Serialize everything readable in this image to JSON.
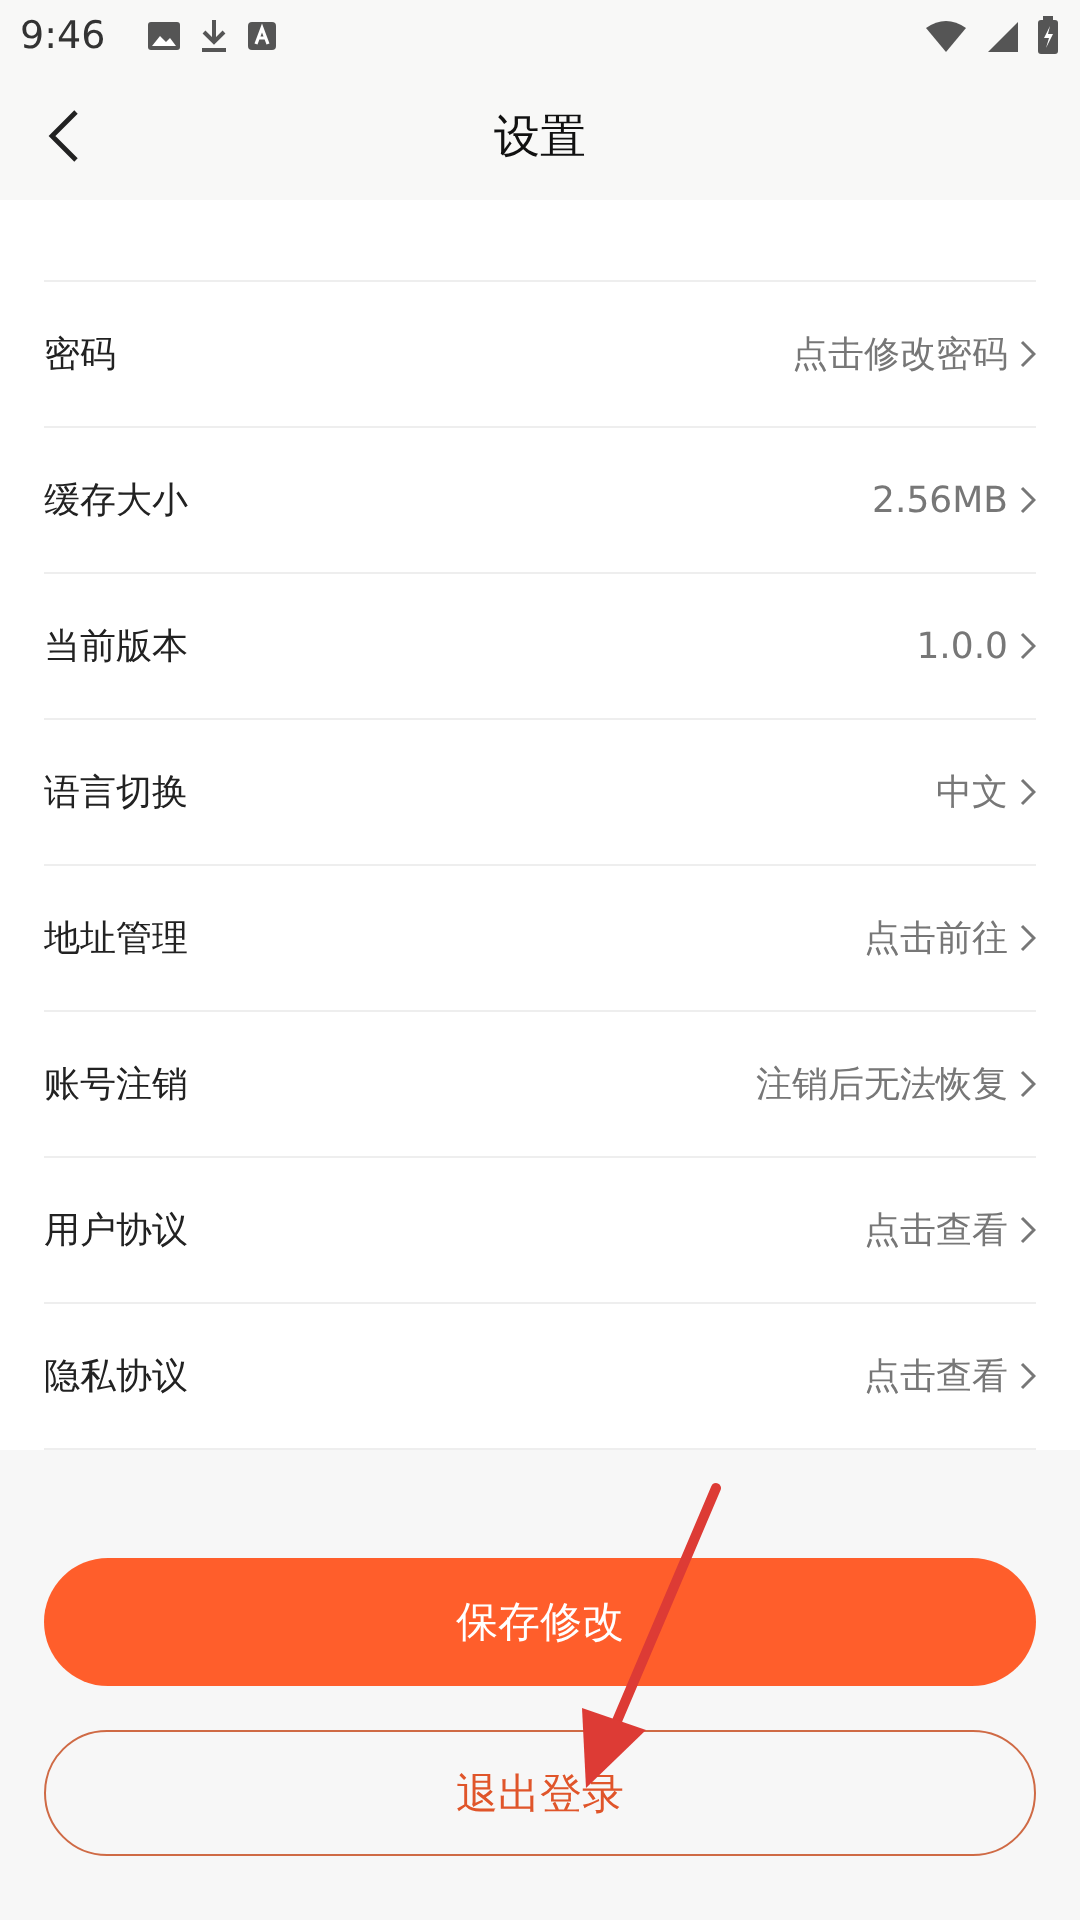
{
  "status_bar": {
    "time": "9:46"
  },
  "header": {
    "title": "设置"
  },
  "settings": [
    {
      "label": "密码",
      "value": "点击修改密码"
    },
    {
      "label": "缓存大小",
      "value": "2.56MB"
    },
    {
      "label": "当前版本",
      "value": "1.0.0"
    },
    {
      "label": "语言切换",
      "value": "中文"
    },
    {
      "label": "地址管理",
      "value": "点击前往"
    },
    {
      "label": "账号注销",
      "value": "注销后无法恢复"
    },
    {
      "label": "用户协议",
      "value": "点击查看"
    },
    {
      "label": "隐私协议",
      "value": "点击查看"
    }
  ],
  "buttons": [
    {
      "label": "保存修改",
      "kind": "primary"
    },
    {
      "label": "退出登录",
      "kind": "outline"
    }
  ]
}
